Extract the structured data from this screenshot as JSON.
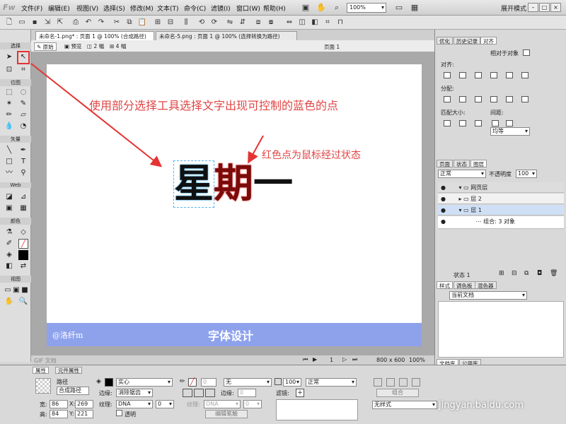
{
  "app": {
    "logo": "Fw",
    "mode": "展开模式",
    "zoom": "100%"
  },
  "menu": [
    "文件(F)",
    "编辑(E)",
    "视图(V)",
    "选择(S)",
    "修改(M)",
    "文本(T)",
    "命令(C)",
    "滤镜(I)",
    "窗口(W)",
    "帮助(H)"
  ],
  "doc_tabs": [
    "未命名-1.png* : 页面 1 @ 100% (合成路径)",
    "未命名-5.png : 页面 1 @ 100% (选择转换为路径)"
  ],
  "view_tabs": [
    "原始",
    "预览",
    "2 幅",
    "4 幅"
  ],
  "page_label": "页面 1",
  "tools": {
    "select_label": "选择",
    "bitmap_label": "位图",
    "vector_label": "矢量",
    "web_label": "Web",
    "color_label": "颜色",
    "view_label": "视图"
  },
  "canvas": {
    "annotation_1": "使用部分选择工具选择文字出现可控制的蓝色的点",
    "annotation_2": "红色点为鼠标经过状态",
    "glyph_1": "星",
    "glyph_2": "期",
    "glyph_3": "一",
    "watermark": "@洛纤m",
    "banner_title": "字体设计"
  },
  "status": {
    "page_number": "1",
    "size": "800 x 600",
    "zoom": "100%",
    "left_text": "GIF 文档"
  },
  "properties": {
    "tab_props": "属性",
    "tab_symbol": "元件属性",
    "object_type": "路径",
    "object_name": "合成路径",
    "width_label": "宽:",
    "width": "86",
    "height_label": "高:",
    "height": "84",
    "x_label": "X:",
    "x": "269",
    "y_label": "Y:",
    "y": "221",
    "stroke_style": "实心",
    "edge_label": "边缘:",
    "edge_value": "消除锯齿",
    "texture_label": "纹理:",
    "texture_value": "DNA",
    "texture_amount": "0",
    "transparent_label": "透明",
    "fill_none": "无",
    "fill_edge_label": "边缘:",
    "fill_edge": "0",
    "fill_texture_label": "纹理:",
    "fill_texture_value": "DNA",
    "fill_texture_amount": "0",
    "edit_stroke": "编辑笔触",
    "opacity": "100",
    "blend": "正常",
    "filter_label": "滤镜:",
    "group_btn": "组合",
    "style_value": "无样式"
  },
  "right_panel": {
    "tabs_top": [
      "优化",
      "历史记录",
      "对齐"
    ],
    "relative_label": "相对于对象",
    "align_label": "对齐:",
    "distribute_label": "分配:",
    "match_size_label": "匹配大小:",
    "spacing_label": "间距:",
    "spacing_value": "均等",
    "tabs_layers": [
      "页面",
      "状态",
      "图层"
    ],
    "blend_mode": "正常",
    "opacity_label": "不透明度",
    "opacity_value": "100",
    "layers": [
      "网页层",
      "层 2",
      "层 1",
      "组合: 3 对象"
    ],
    "state_label": "状态 1",
    "tabs_style": [
      "样式",
      "调色板",
      "混色器"
    ],
    "current_doc": "当前文档",
    "tabs_lib": [
      "文档库",
      "公用库"
    ]
  },
  "site_watermark": "jingyan.baidu.com",
  "colors": {
    "annotation": "#e04545",
    "banner": "#8ea2ec",
    "highlight": "#e53333",
    "selection_points": "#2aa9e6"
  }
}
